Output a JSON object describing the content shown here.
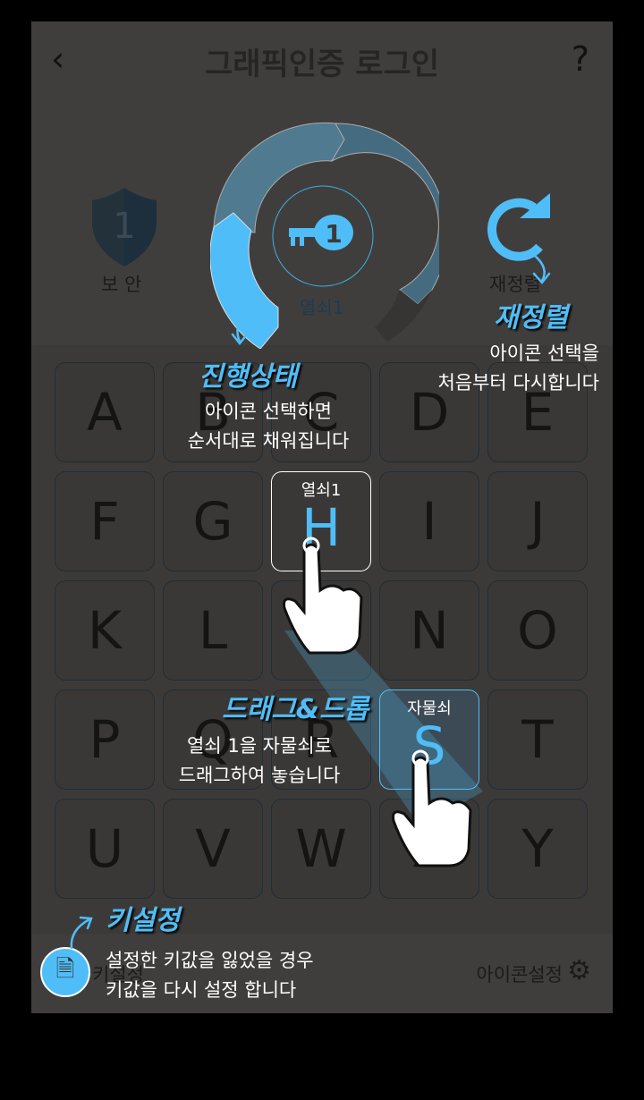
{
  "header": {
    "title": "그래픽인증 로그인",
    "back_icon": "chevron-left-icon",
    "help_label": "?"
  },
  "security": {
    "level": "1",
    "label": "보 안"
  },
  "progress": {
    "key_number": "1",
    "label": "열쇠1",
    "filled_segments": 1,
    "total_segments": 3
  },
  "reset": {
    "label": "재정렬"
  },
  "tiles": [
    "A",
    "B",
    "C",
    "D",
    "E",
    "F",
    "G",
    "H",
    "I",
    "J",
    "K",
    "L",
    "M",
    "N",
    "O",
    "P",
    "Q",
    "R",
    "S",
    "T",
    "U",
    "V",
    "W",
    "X",
    "Y"
  ],
  "selected_tile": {
    "letter": "H",
    "caption": "열쇠1"
  },
  "drop_tile": {
    "letter": "S",
    "caption": "자물쇠"
  },
  "bottom": {
    "key_setting_label": "키설정",
    "icon_setting_label": "아이콘설정"
  },
  "tutorial": {
    "progress_title": "진행상태",
    "progress_desc": [
      "아이콘 선택하면",
      "순서대로 채워집니다"
    ],
    "reset_title": "재정렬",
    "reset_desc": [
      "아이콘 선택을",
      "처음부터 다시합니다"
    ],
    "drag_title": "드래그&드롭",
    "drag_desc": [
      "열쇠 1을 자물쇠로",
      "드래그하여 놓습니다"
    ],
    "key_title": "키설정",
    "key_desc": [
      "설정한 키값을 잃었을 경우",
      "키값을 다시 설정 합니다"
    ]
  },
  "colors": {
    "accent": "#4fbef8",
    "panel": "#3c3a38"
  }
}
